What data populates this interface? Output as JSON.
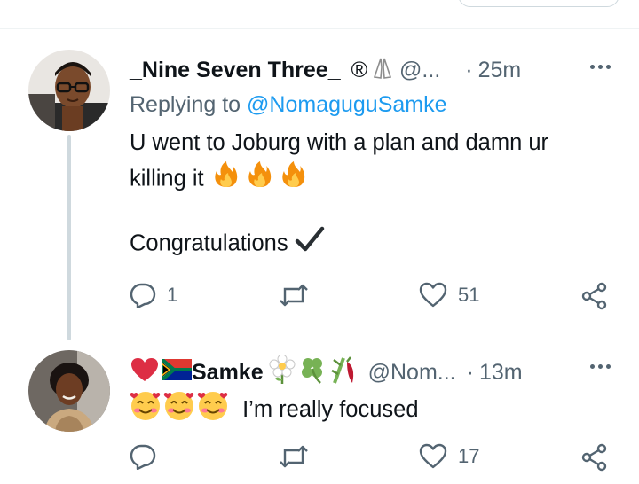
{
  "tweets": [
    {
      "name": "_Nine Seven Three_",
      "name_suffix": "®",
      "handle": "@...",
      "dot": "·",
      "time": "25m",
      "replying_prefix": "Replying to",
      "replying_handle": "@NomaguguSamke",
      "line1": "U went to Joburg with a plan and damn ur",
      "line2": "killing it",
      "line3": "Congratulations",
      "replies": "1",
      "retweets": "",
      "likes": "51"
    },
    {
      "name": "Samke",
      "handle": "@Nom...",
      "dot": "·",
      "time": "13m",
      "text": "I’m really focused",
      "replies": "",
      "retweets": "",
      "likes": "17"
    }
  ],
  "colors": {
    "link": "#1d9bf0",
    "muted": "#536471",
    "text": "#0f1419",
    "thread": "#cfd9de"
  }
}
